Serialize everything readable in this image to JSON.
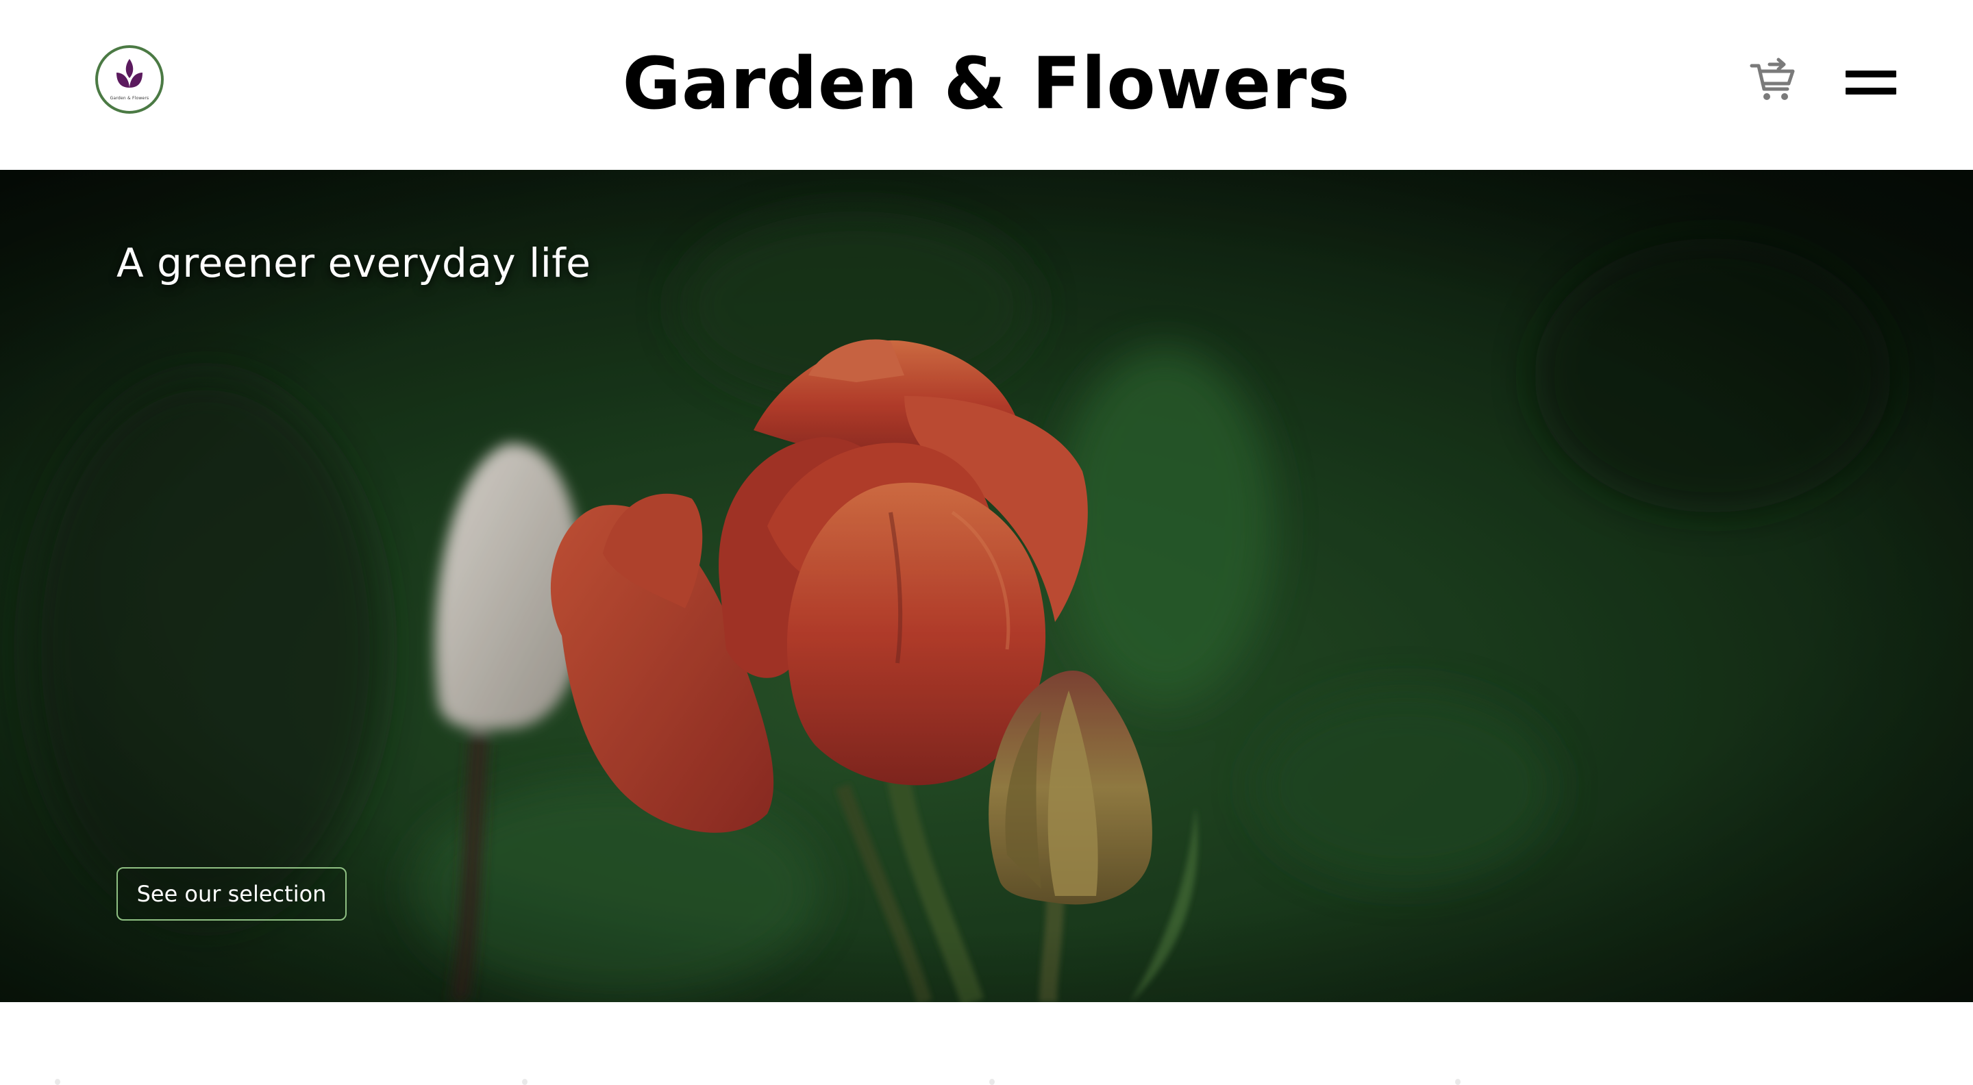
{
  "header": {
    "logo_text": "Garden & Flowers",
    "site_title": "Garden & Flowers",
    "cart_icon": "add-to-cart-icon",
    "menu_icon": "hamburger-menu-icon"
  },
  "hero": {
    "tagline": "A greener everyday life",
    "cta_label": "See our selection",
    "image_subject": "red-tulip-photo"
  },
  "colors": {
    "logo_ring": "#4b7a44",
    "logo_flower": "#5b1a5e",
    "cta_border": "#8fc083",
    "title": "#000000",
    "cart_icon": "#7a7a7a"
  }
}
